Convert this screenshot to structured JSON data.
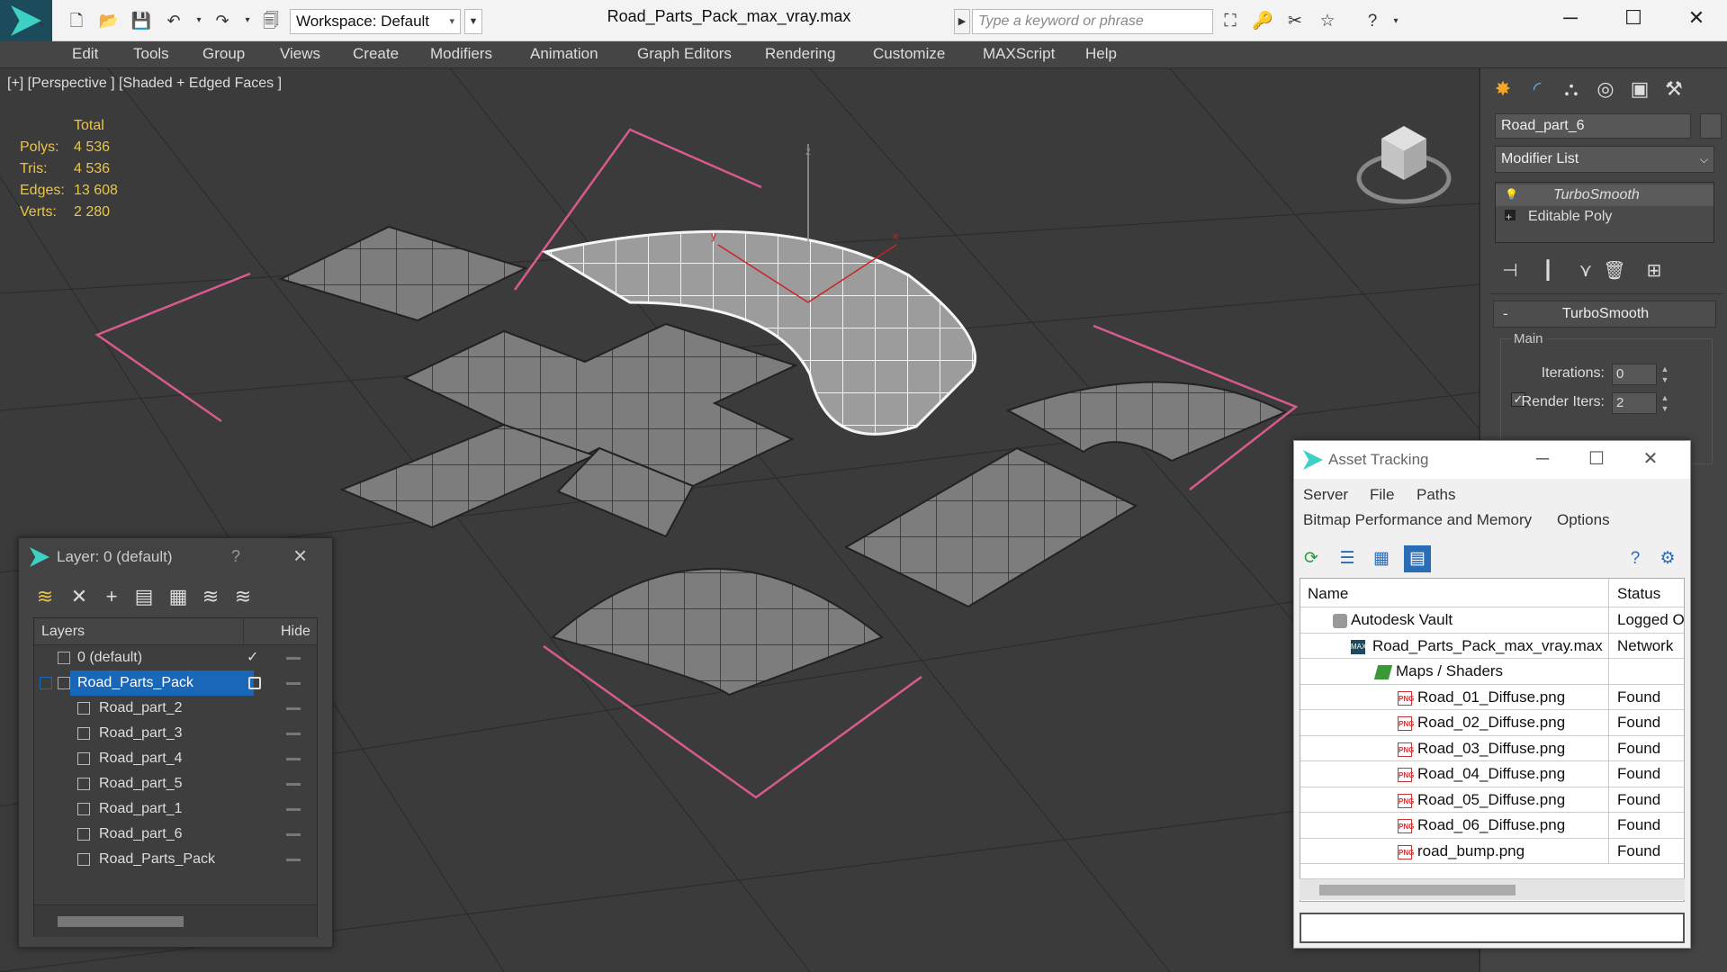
{
  "titlebar": {
    "workspace_label": "Workspace: Default",
    "document_title": "Road_Parts_Pack_max_vray.max",
    "search_placeholder": "Type a keyword or phrase"
  },
  "menu": [
    "Edit",
    "Tools",
    "Group",
    "Views",
    "Create",
    "Modifiers",
    "Animation",
    "Graph Editors",
    "Rendering",
    "Customize",
    "MAXScript",
    "Help"
  ],
  "viewport": {
    "label": "[+] [Perspective ] [Shaded + Edged Faces ]",
    "stats": {
      "header": "Total",
      "polys_label": "Polys:",
      "polys": "4 536",
      "tris_label": "Tris:",
      "tris": "4 536",
      "edges_label": "Edges:",
      "edges": "13 608",
      "verts_label": "Verts:",
      "verts": "2 280"
    },
    "axis_labels": {
      "z": "z",
      "x": "x",
      "y": "y"
    }
  },
  "command_panel": {
    "object_name": "Road_part_6",
    "modifier_list": "Modifier List",
    "stack": [
      "TurboSmooth",
      "Editable Poly"
    ],
    "rollout_title": "TurboSmooth",
    "group_label": "Main",
    "iterations_label": "Iterations:",
    "iterations_value": "0",
    "render_iters_label": "Render Iters:",
    "render_iters_value": "2"
  },
  "layer_window": {
    "title": "Layer: 0 (default)",
    "help": "?",
    "columns": {
      "name": "Layers",
      "hide": "Hide"
    },
    "rows": [
      {
        "name": "0 (default)"
      },
      {
        "name": "Road_Parts_Pack"
      },
      {
        "name": "Road_part_2"
      },
      {
        "name": "Road_part_3"
      },
      {
        "name": "Road_part_4"
      },
      {
        "name": "Road_part_5"
      },
      {
        "name": "Road_part_1"
      },
      {
        "name": "Road_part_6"
      },
      {
        "name": "Road_Parts_Pack"
      }
    ]
  },
  "asset_window": {
    "title": "Asset Tracking",
    "menus": [
      "Server",
      "File",
      "Paths",
      "Bitmap Performance and Memory",
      "Options"
    ],
    "columns": {
      "name": "Name",
      "status": "Status"
    },
    "rows": [
      {
        "name": "Autodesk Vault",
        "status": "Logged Out",
        "icon": "vault-icon"
      },
      {
        "name": "Road_Parts_Pack_max_vray.max",
        "status": "Network",
        "icon": "max-file-icon"
      },
      {
        "name": "Maps / Shaders",
        "status": "",
        "icon": "folder-icon"
      },
      {
        "name": "Road_01_Diffuse.png",
        "status": "Found",
        "icon": "png-icon"
      },
      {
        "name": "Road_02_Diffuse.png",
        "status": "Found",
        "icon": "png-icon"
      },
      {
        "name": "Road_03_Diffuse.png",
        "status": "Found",
        "icon": "png-icon"
      },
      {
        "name": "Road_04_Diffuse.png",
        "status": "Found",
        "icon": "png-icon"
      },
      {
        "name": "Road_05_Diffuse.png",
        "status": "Found",
        "icon": "png-icon"
      },
      {
        "name": "Road_06_Diffuse.png",
        "status": "Found",
        "icon": "png-icon"
      },
      {
        "name": "road_bump.png",
        "status": "Found",
        "icon": "png-icon"
      }
    ]
  },
  "colors": {
    "viewport_bg": "#3b3b3b",
    "selection_blue": "#1967b8",
    "stats_yellow": "#e8c54a",
    "spline_pink": "#d95a8f",
    "accent_teal": "#3ed0c4"
  }
}
